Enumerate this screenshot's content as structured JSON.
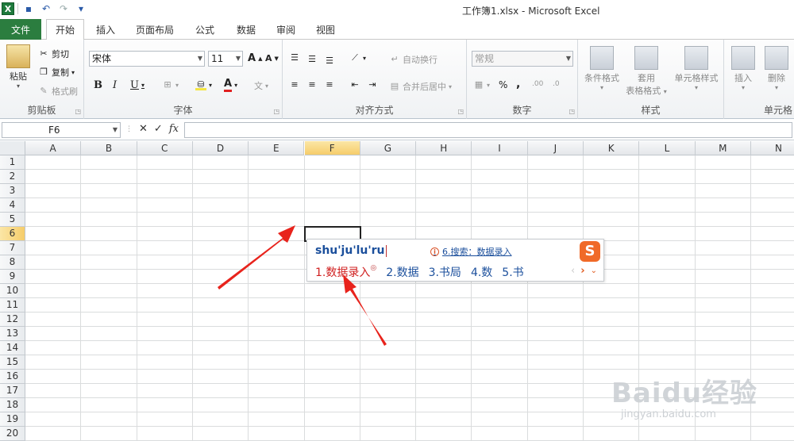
{
  "window": {
    "title": "工作簿1.xlsx  -  Microsoft Excel"
  },
  "qat": {
    "app_icon_label": "X"
  },
  "tabs": {
    "file": "文件",
    "items": [
      "开始",
      "插入",
      "页面布局",
      "公式",
      "数据",
      "审阅",
      "视图"
    ]
  },
  "ribbon": {
    "clipboard": {
      "label": "剪贴板",
      "paste": "粘贴",
      "cut": "剪切",
      "copy": "复制",
      "format_painter": "格式刷"
    },
    "font": {
      "label": "字体",
      "font_name": "宋体",
      "font_size": "11",
      "bold": "B",
      "italic": "I",
      "underline": "U",
      "grow": "A",
      "shrink": "A",
      "color_letter": "A",
      "phonetic": "文"
    },
    "alignment": {
      "label": "对齐方式",
      "wrap_text": "自动换行",
      "merge_center": "合并后居中"
    },
    "number": {
      "label": "数字",
      "format": "常规",
      "percent": "%",
      "comma": ",",
      "inc_decimal": ".00",
      "dec_decimal": ".0"
    },
    "styles": {
      "label": "样式",
      "conditional": "条件格式",
      "table_format_1": "套用",
      "table_format_2": "表格格式",
      "cell_styles": "单元格样式"
    },
    "cells": {
      "label": "单元格",
      "insert": "插入",
      "delete": "删除"
    }
  },
  "formula_bar": {
    "name_box": "F6",
    "fx": "fx",
    "cancel": "✕",
    "enter": "✓",
    "value": ""
  },
  "sheet": {
    "columns": [
      "A",
      "B",
      "C",
      "D",
      "E",
      "F",
      "G",
      "H",
      "I",
      "J",
      "K",
      "L",
      "M",
      "N"
    ],
    "rows": [
      "1",
      "2",
      "3",
      "4",
      "5",
      "6",
      "7",
      "8",
      "9",
      "10",
      "11",
      "12",
      "13",
      "14",
      "15",
      "16",
      "17",
      "18",
      "19",
      "20"
    ],
    "selected_column": "F",
    "selected_row": "6"
  },
  "ime": {
    "pinyin": "shu'ju'lu'ru",
    "search": "6.搜索：数据录入",
    "info_icon": "i",
    "logo": "S",
    "candidates": [
      "1.数据录入",
      "2.数据",
      "3.书局",
      "4.数",
      "5.书"
    ],
    "candidate_mark": "◎",
    "nav_prev": "‹",
    "nav_next": "›",
    "nav_more": "⌄",
    "accent": "#f06a28",
    "text_color": "#1b4f9c",
    "highlight_color": "#d02020"
  },
  "watermark": {
    "logo": "Baidu经验",
    "url": "jingyan.baidu.com"
  },
  "annotations": {
    "arrow_color": "#e8231c"
  }
}
